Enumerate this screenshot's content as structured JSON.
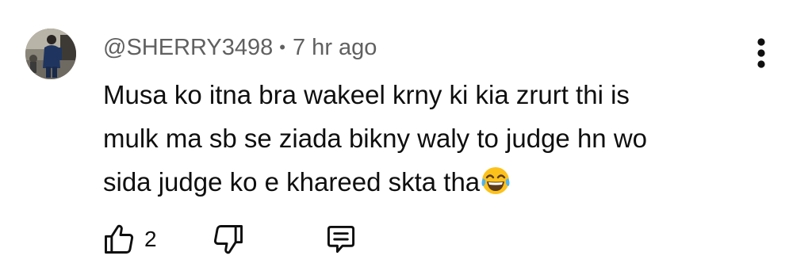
{
  "comment": {
    "author": "@SHERRY3498",
    "separator": "•",
    "time": "7 hr ago",
    "text_lines": [
      "Musa ko itna bra wakeel krny ki kia zrurt thi is",
      "mulk ma sb se ziada bikny waly to judge hn wo",
      "sida judge ko e khareed skta tha"
    ],
    "emoji": "face-with-tears-of-joy",
    "likes": "2"
  },
  "icons": {
    "like": "thumbs-up-icon",
    "dislike": "thumbs-down-icon",
    "reply": "reply-comment-icon",
    "more": "more-vertical-icon"
  },
  "colors": {
    "meta_text": "#606060",
    "body_text": "#0f0f0f",
    "background": "#ffffff"
  }
}
